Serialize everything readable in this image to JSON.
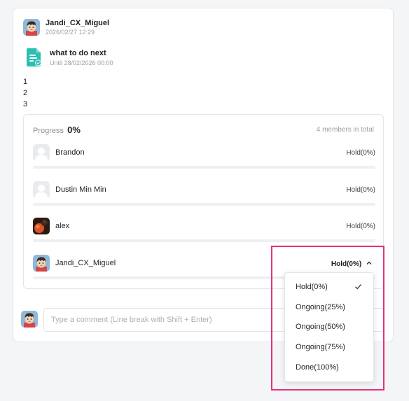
{
  "post": {
    "author": "Jandi_CX_Miguel",
    "timestamp": "2026/02/27 12:29"
  },
  "task": {
    "icon": "task-document-icon",
    "title": "what to do next",
    "due": "Until 28/02/2026 00:00"
  },
  "body_lines": [
    "1",
    "2",
    "3"
  ],
  "progress": {
    "label": "Progress",
    "value": "0%",
    "members_total": "4 members in total",
    "members": [
      {
        "name": "Brandon",
        "status": "Hold(0%)",
        "progress": 0,
        "avatar": "default-avatar-icon"
      },
      {
        "name": "Dustin Min Min",
        "status": "Hold(0%)",
        "progress": 0,
        "avatar": "default-avatar-icon"
      },
      {
        "name": "alex",
        "status": "Hold(0%)",
        "progress": 0,
        "avatar": "photo-avatar"
      },
      {
        "name": "Jandi_CX_Miguel",
        "status": "Hold(0%)",
        "progress": 0,
        "avatar": "user-avatar"
      }
    ]
  },
  "status_dropdown": {
    "selected": "Hold(0%)",
    "options": [
      "Hold(0%)",
      "Ongoing(25%)",
      "Ongoing(50%)",
      "Ongoing(75%)",
      "Done(100%)"
    ]
  },
  "comment": {
    "placeholder": "Type a comment (Line break with Shift + Enter)"
  },
  "colors": {
    "accent": "#4a8cf0",
    "highlight": "#e0337f",
    "task_icon": "#2bbfb3"
  }
}
